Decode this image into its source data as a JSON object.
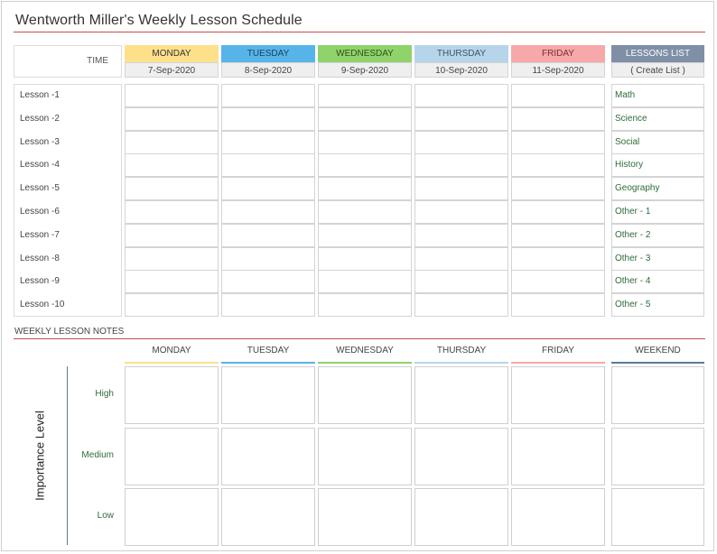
{
  "title": "Wentworth Miller's Weekly Lesson Schedule",
  "time_label": "TIME",
  "days": [
    {
      "name": "MONDAY",
      "date": "7-Sep-2020",
      "color": "#ffe08a",
      "text": "#333333"
    },
    {
      "name": "TUESDAY",
      "date": "8-Sep-2020",
      "color": "#56b4e9",
      "text": "#1f3f5a"
    },
    {
      "name": "WEDNESDAY",
      "date": "9-Sep-2020",
      "color": "#8fd36a",
      "text": "#2f4f1f"
    },
    {
      "name": "THURSDAY",
      "date": "10-Sep-2020",
      "color": "#b7d5ea",
      "text": "#3a5566"
    },
    {
      "name": "FRIDAY",
      "date": "11-Sep-2020",
      "color": "#f7a8a8",
      "text": "#7a2f2f"
    }
  ],
  "lessons_list": {
    "header": "LESSONS LIST",
    "header_color": "#7f8fa6",
    "create": "( Create List )",
    "items": [
      "Math",
      "Science",
      "Social",
      "History",
      "Geography",
      "Other - 1",
      "Other - 2",
      "Other - 3",
      "Other - 4",
      "Other - 5"
    ]
  },
  "lessons": [
    "Lesson -1",
    "Lesson -2",
    "Lesson -3",
    "Lesson -4",
    "Lesson -5",
    "Lesson -6",
    "Lesson -7",
    "Lesson -8",
    "Lesson -9",
    "Lesson -10"
  ],
  "notes": {
    "title": "WEEKLY LESSON NOTES",
    "days": [
      {
        "name": "MONDAY",
        "color": "#ffe08a"
      },
      {
        "name": "TUESDAY",
        "color": "#56b4e9"
      },
      {
        "name": "WEDNESDAY",
        "color": "#8fd36a"
      },
      {
        "name": "THURSDAY",
        "color": "#b7d5ea"
      },
      {
        "name": "FRIDAY",
        "color": "#f7a8a8"
      },
      {
        "name": "WEEKEND",
        "color": "#5a7a96"
      }
    ],
    "importance_label": "Importance Level",
    "levels": [
      "High",
      "Medium",
      "Low"
    ]
  },
  "colors": {
    "accent_rule": "#c0504d",
    "level_text": "#2f6b3a"
  }
}
